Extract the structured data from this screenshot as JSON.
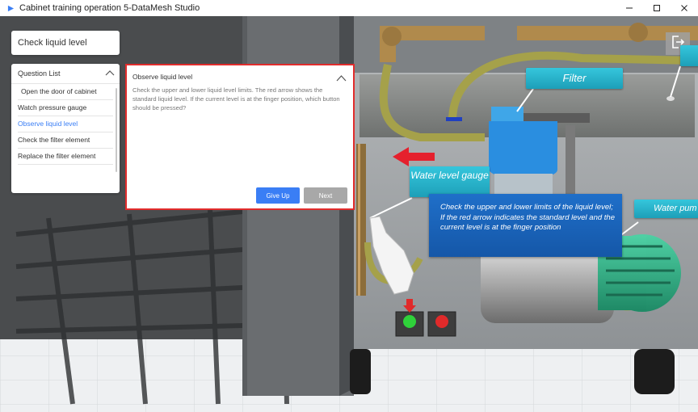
{
  "window": {
    "title": "Cabinet training operation 5-DataMesh Studio"
  },
  "task": {
    "label": "Check liquid level"
  },
  "question_list": {
    "header": "Question List",
    "items": [
      {
        "label": "Open the door of cabinet"
      },
      {
        "label": "Watch pressure gauge"
      },
      {
        "label": "Observe liquid level"
      },
      {
        "label": "Check the filter element"
      },
      {
        "label": "Replace the filter element"
      }
    ],
    "active_index": 2
  },
  "dialog": {
    "title": "Observe liquid level",
    "body": "Check the upper and lower liquid level limits. The red arrow shows the standard liquid level. If the current level is at the finger position, which button should be pressed?",
    "give_up_label": "Give Up",
    "next_label": "Next"
  },
  "scene_labels": {
    "filter": "Filter",
    "water_level_gauge": "Water level gauge",
    "water_pump": "Water pum",
    "info_lines": [
      "Check the upper and lower limits of the liquid level;",
      "If the red arrow indicates the standard level and the current level is at the finger position"
    ]
  },
  "colors": {
    "accent": "#3a7ef5",
    "dialog_border": "#e12c2c",
    "tag_cyan": "#26b2cc",
    "info_blue": "#1a63b9",
    "button_green": "#2fd13a",
    "button_red": "#e02a2a"
  },
  "icons": {
    "app": "app-logo-icon",
    "exit": "exit-icon",
    "collapse": "chevron-up-icon"
  }
}
